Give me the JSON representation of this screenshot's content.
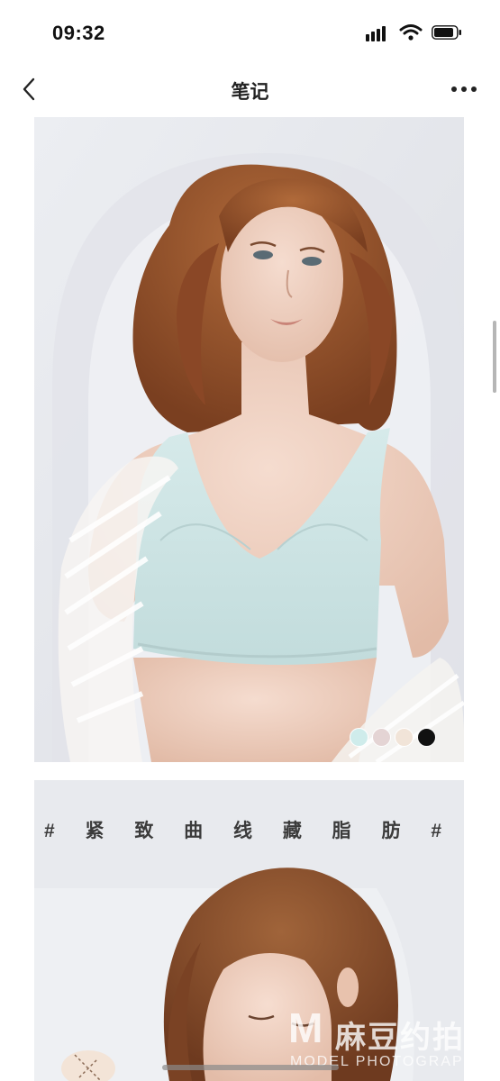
{
  "status_bar": {
    "time": "09:32",
    "icons": [
      "signal-icon",
      "wifi-icon",
      "battery-icon"
    ]
  },
  "nav": {
    "title": "笔记",
    "back_icon": "chevron-left-icon",
    "more_icon": "more-icon"
  },
  "post": {
    "images": [
      {
        "subject": "model wearing light mint seamless wireless bra with sheer striped white robe",
        "swatches": [
          "#cfeceb",
          "#e4d4d4",
          "#f1e4d8",
          "#111111"
        ]
      },
      {
        "subject": "model with auburn wavy hair looking down",
        "tagline": "# 紧 致 曲 线 藏 脂 肪 #"
      }
    ]
  },
  "watermark": {
    "logo_letter": "M",
    "text": "麻豆约拍",
    "subtext": "MODEL PHOTOGRAPH"
  },
  "colors": {
    "background": "#ffffff",
    "text": "#111111",
    "bra": "#cfe4e4",
    "hair": "#9a5530"
  }
}
